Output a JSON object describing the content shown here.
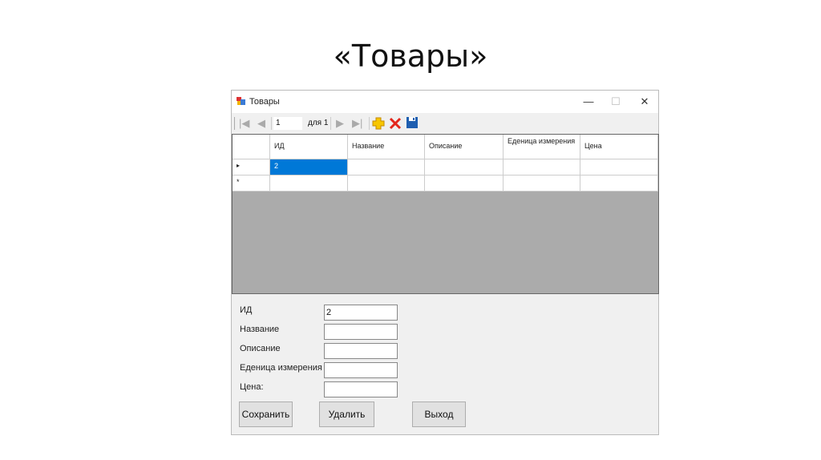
{
  "slide": {
    "title": "«Товары»"
  },
  "window": {
    "title": "Товары",
    "minimize": "—",
    "maximize": "☐",
    "close": "✕"
  },
  "navigator": {
    "position": "1",
    "count_label": "для 1",
    "icons": [
      "move-first-icon",
      "move-previous-icon",
      "move-next-icon",
      "move-last-icon",
      "add-icon",
      "delete-icon",
      "save-icon"
    ]
  },
  "grid": {
    "columns": [
      "ИД",
      "Название",
      "Описание",
      "Еденица измерения",
      "Цена"
    ],
    "rows": [
      {
        "indicator": "▸",
        "cells": [
          "2",
          "",
          "",
          "",
          ""
        ]
      },
      {
        "indicator": "*",
        "cells": [
          "",
          "",
          "",
          "",
          ""
        ]
      }
    ],
    "selection_color": "#0078d7"
  },
  "form": {
    "fields": [
      {
        "label": "ИД",
        "value": "2"
      },
      {
        "label": "Название",
        "value": ""
      },
      {
        "label": "Описание",
        "value": ""
      },
      {
        "label": "Еденица измерения",
        "value": ""
      },
      {
        "label": "Цена:",
        "value": ""
      }
    ]
  },
  "buttons": {
    "save": "Сохранить",
    "delete": "Удалить",
    "exit": "Выход"
  }
}
